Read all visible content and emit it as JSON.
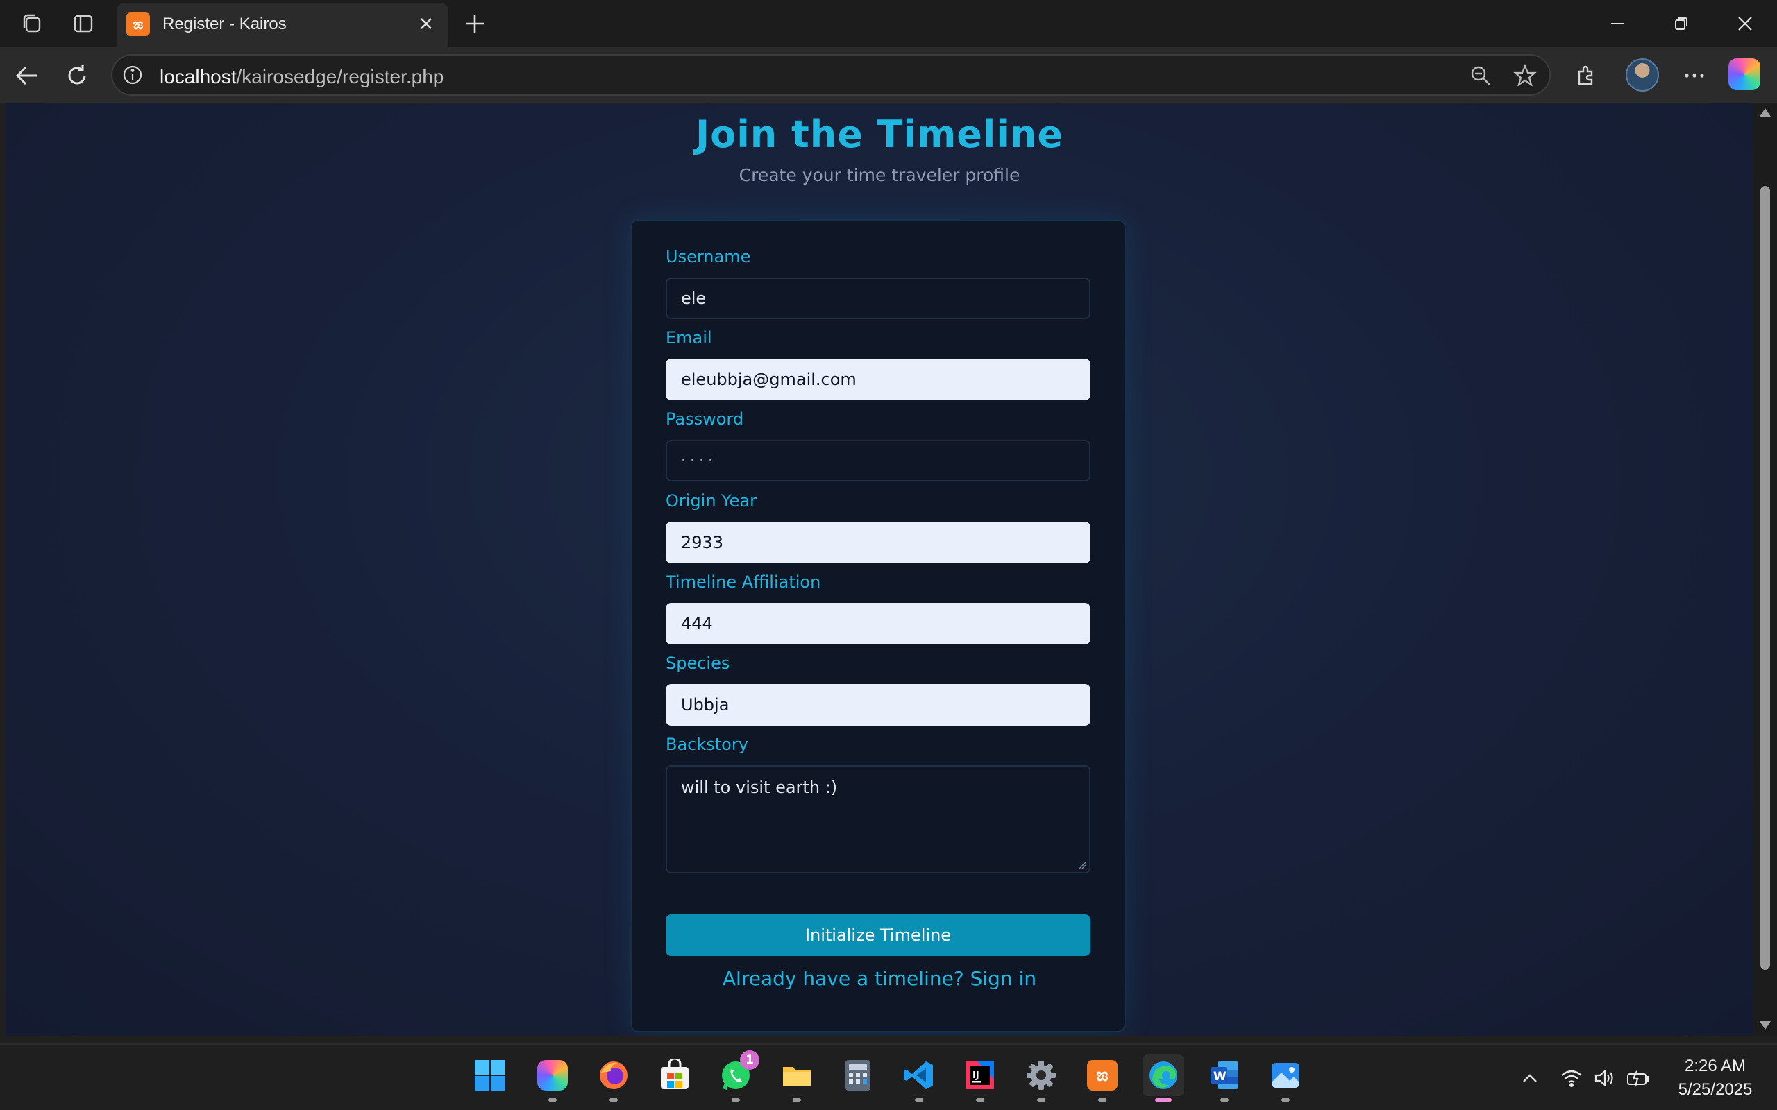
{
  "browser": {
    "tab_title": "Register - Kairos",
    "address": {
      "host": "localhost",
      "path": "/kairosedge/register.php"
    }
  },
  "page": {
    "title": "Join the Timeline",
    "subtitle": "Create your time traveler profile"
  },
  "form": {
    "username": {
      "label": "Username",
      "value": "ele"
    },
    "email": {
      "label": "Email",
      "value": "eleubbja@gmail.com"
    },
    "password": {
      "label": "Password",
      "value": "····"
    },
    "origin_year": {
      "label": "Origin Year",
      "value": "2933"
    },
    "timeline_affiliation": {
      "label": "Timeline Affiliation",
      "value": "444"
    },
    "species": {
      "label": "Species",
      "value": "Ubbja"
    },
    "backstory": {
      "label": "Backstory",
      "value": "will to visit earth :)"
    },
    "submit_label": "Initialize Timeline",
    "signin_link": "Already have a timeline? Sign in"
  },
  "taskbar": {
    "whatsapp_badge": "1",
    "time": "2:26 AM",
    "date": "5/25/2025"
  },
  "colors": {
    "accent": "#1fb6e0",
    "button": "#0a8fb5",
    "page_bg": "#18213a",
    "card_bg": "#0f1726"
  }
}
